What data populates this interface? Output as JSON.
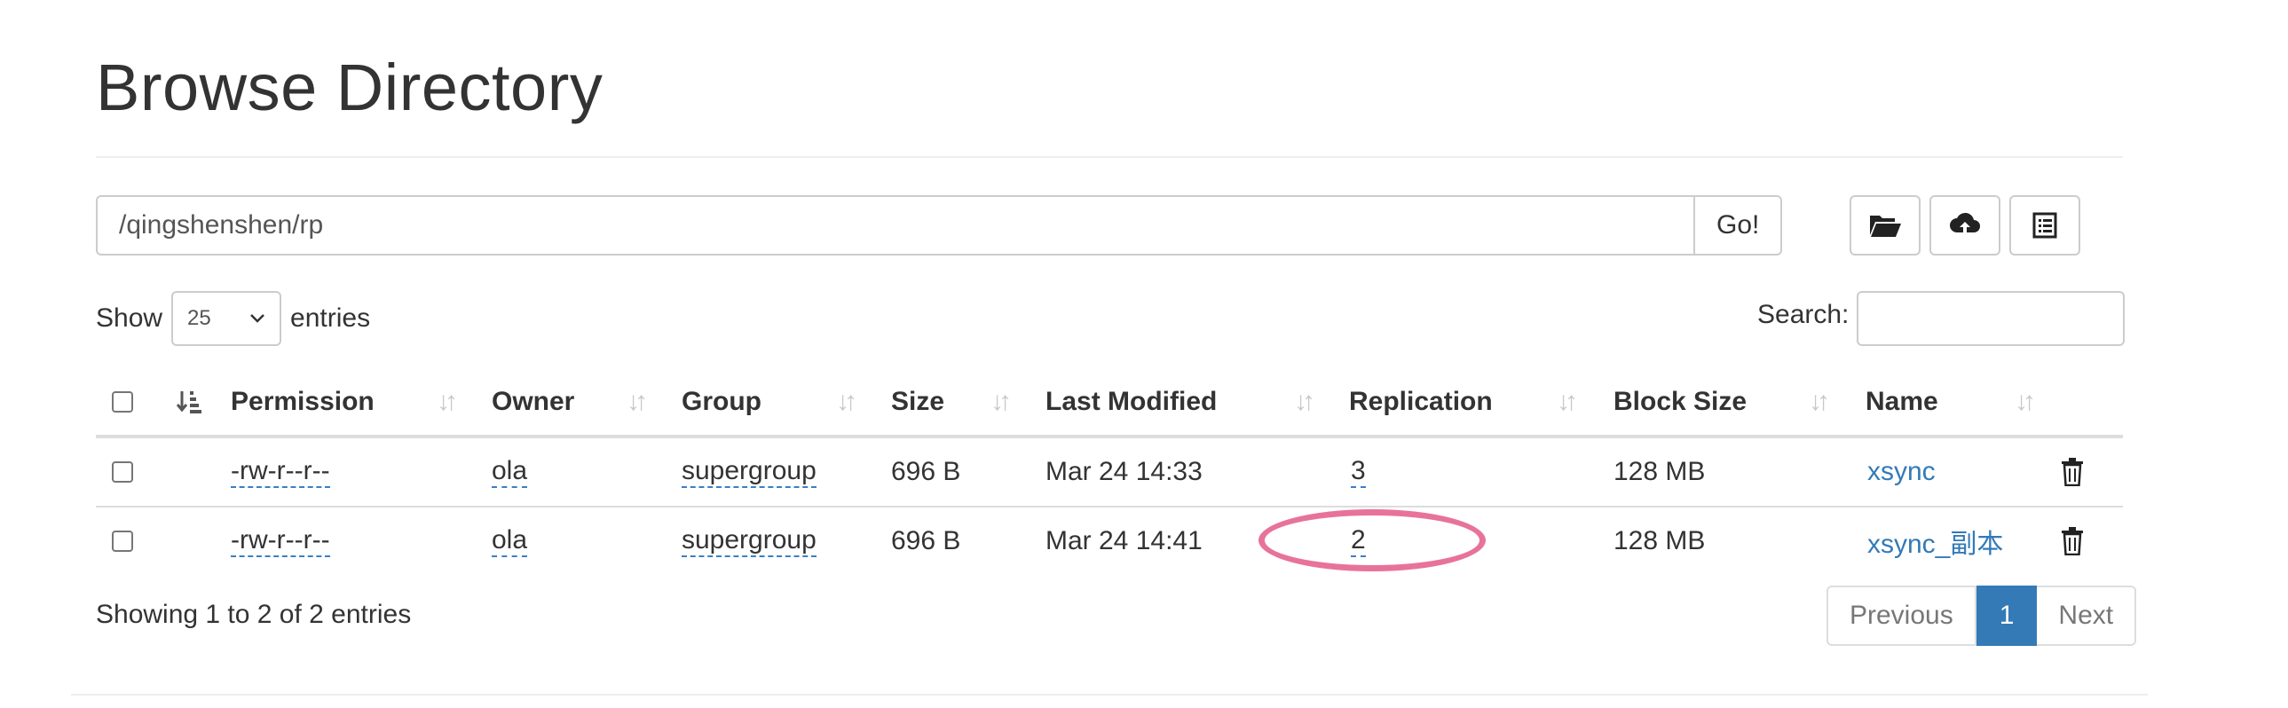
{
  "page": {
    "title": "Browse Directory"
  },
  "path_bar": {
    "value": "/qingshenshen/rp",
    "go_label": "Go!"
  },
  "toolbar": {
    "icons": [
      "folder-open-icon",
      "cloud-upload-icon",
      "list-icon"
    ]
  },
  "show_entries": {
    "show_label": "Show",
    "selected": "25",
    "entries_label": "entries"
  },
  "search": {
    "label": "Search:",
    "value": ""
  },
  "table": {
    "headers": [
      "Permission",
      "Owner",
      "Group",
      "Size",
      "Last Modified",
      "Replication",
      "Block Size",
      "Name"
    ],
    "rows": [
      {
        "permission": "-rw-r--r--",
        "owner": "ola",
        "group": "supergroup",
        "size": "696 B",
        "modified": "Mar 24 14:33",
        "replication": "3",
        "block_size": "128 MB",
        "name": "xsync"
      },
      {
        "permission": "-rw-r--r--",
        "owner": "ola",
        "group": "supergroup",
        "size": "696 B",
        "modified": "Mar 24 14:41",
        "replication": "2",
        "block_size": "128 MB",
        "name": "xsync_副本"
      }
    ]
  },
  "footer": {
    "info": "Showing 1 to 2 of 2 entries"
  },
  "pagination": {
    "previous": "Previous",
    "current": "1",
    "next": "Next"
  },
  "colors": {
    "link": "#337ab7",
    "active_page": "#337ab7",
    "highlight": "#e8739a"
  }
}
